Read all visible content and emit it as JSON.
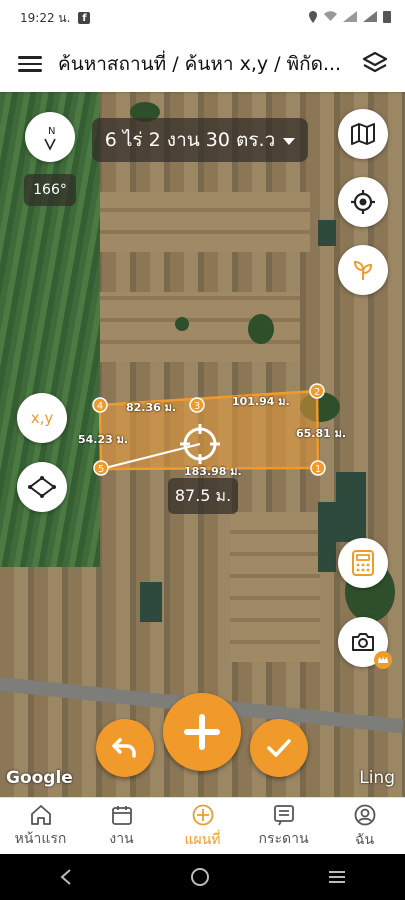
{
  "status_bar": {
    "time": "19:22 น."
  },
  "app_bar": {
    "title": "ค้นหาสถานที่ / ค้นหา x,y / พิกัด..."
  },
  "map": {
    "area_summary": "6 ไร่ 2 งาน 30 ตร.ว",
    "compass_letter": "N",
    "heading": "166°",
    "xy_button": "x,y",
    "vertices": [
      "1",
      "2",
      "3",
      "4",
      "5"
    ],
    "edge_labels": [
      "82.36 ม.",
      "101.94 ม.",
      "65.81 ม.",
      "54.23 ม.",
      "183.98 ม."
    ],
    "distance_to_center": "87.5 ม.",
    "attribution_left": "Google",
    "attribution_right": "Ling"
  },
  "bottom_nav": {
    "items": [
      {
        "label": "หน้าแรก",
        "icon": "home-icon"
      },
      {
        "label": "งาน",
        "icon": "calendar-icon"
      },
      {
        "label": "แผนที่",
        "icon": "add-circle-icon",
        "active": true
      },
      {
        "label": "กระดาน",
        "icon": "board-icon"
      },
      {
        "label": "ฉัน",
        "icon": "profile-icon"
      }
    ]
  },
  "colors": {
    "accent": "#f19a2c",
    "polygon_fill": "#e89a3c"
  }
}
